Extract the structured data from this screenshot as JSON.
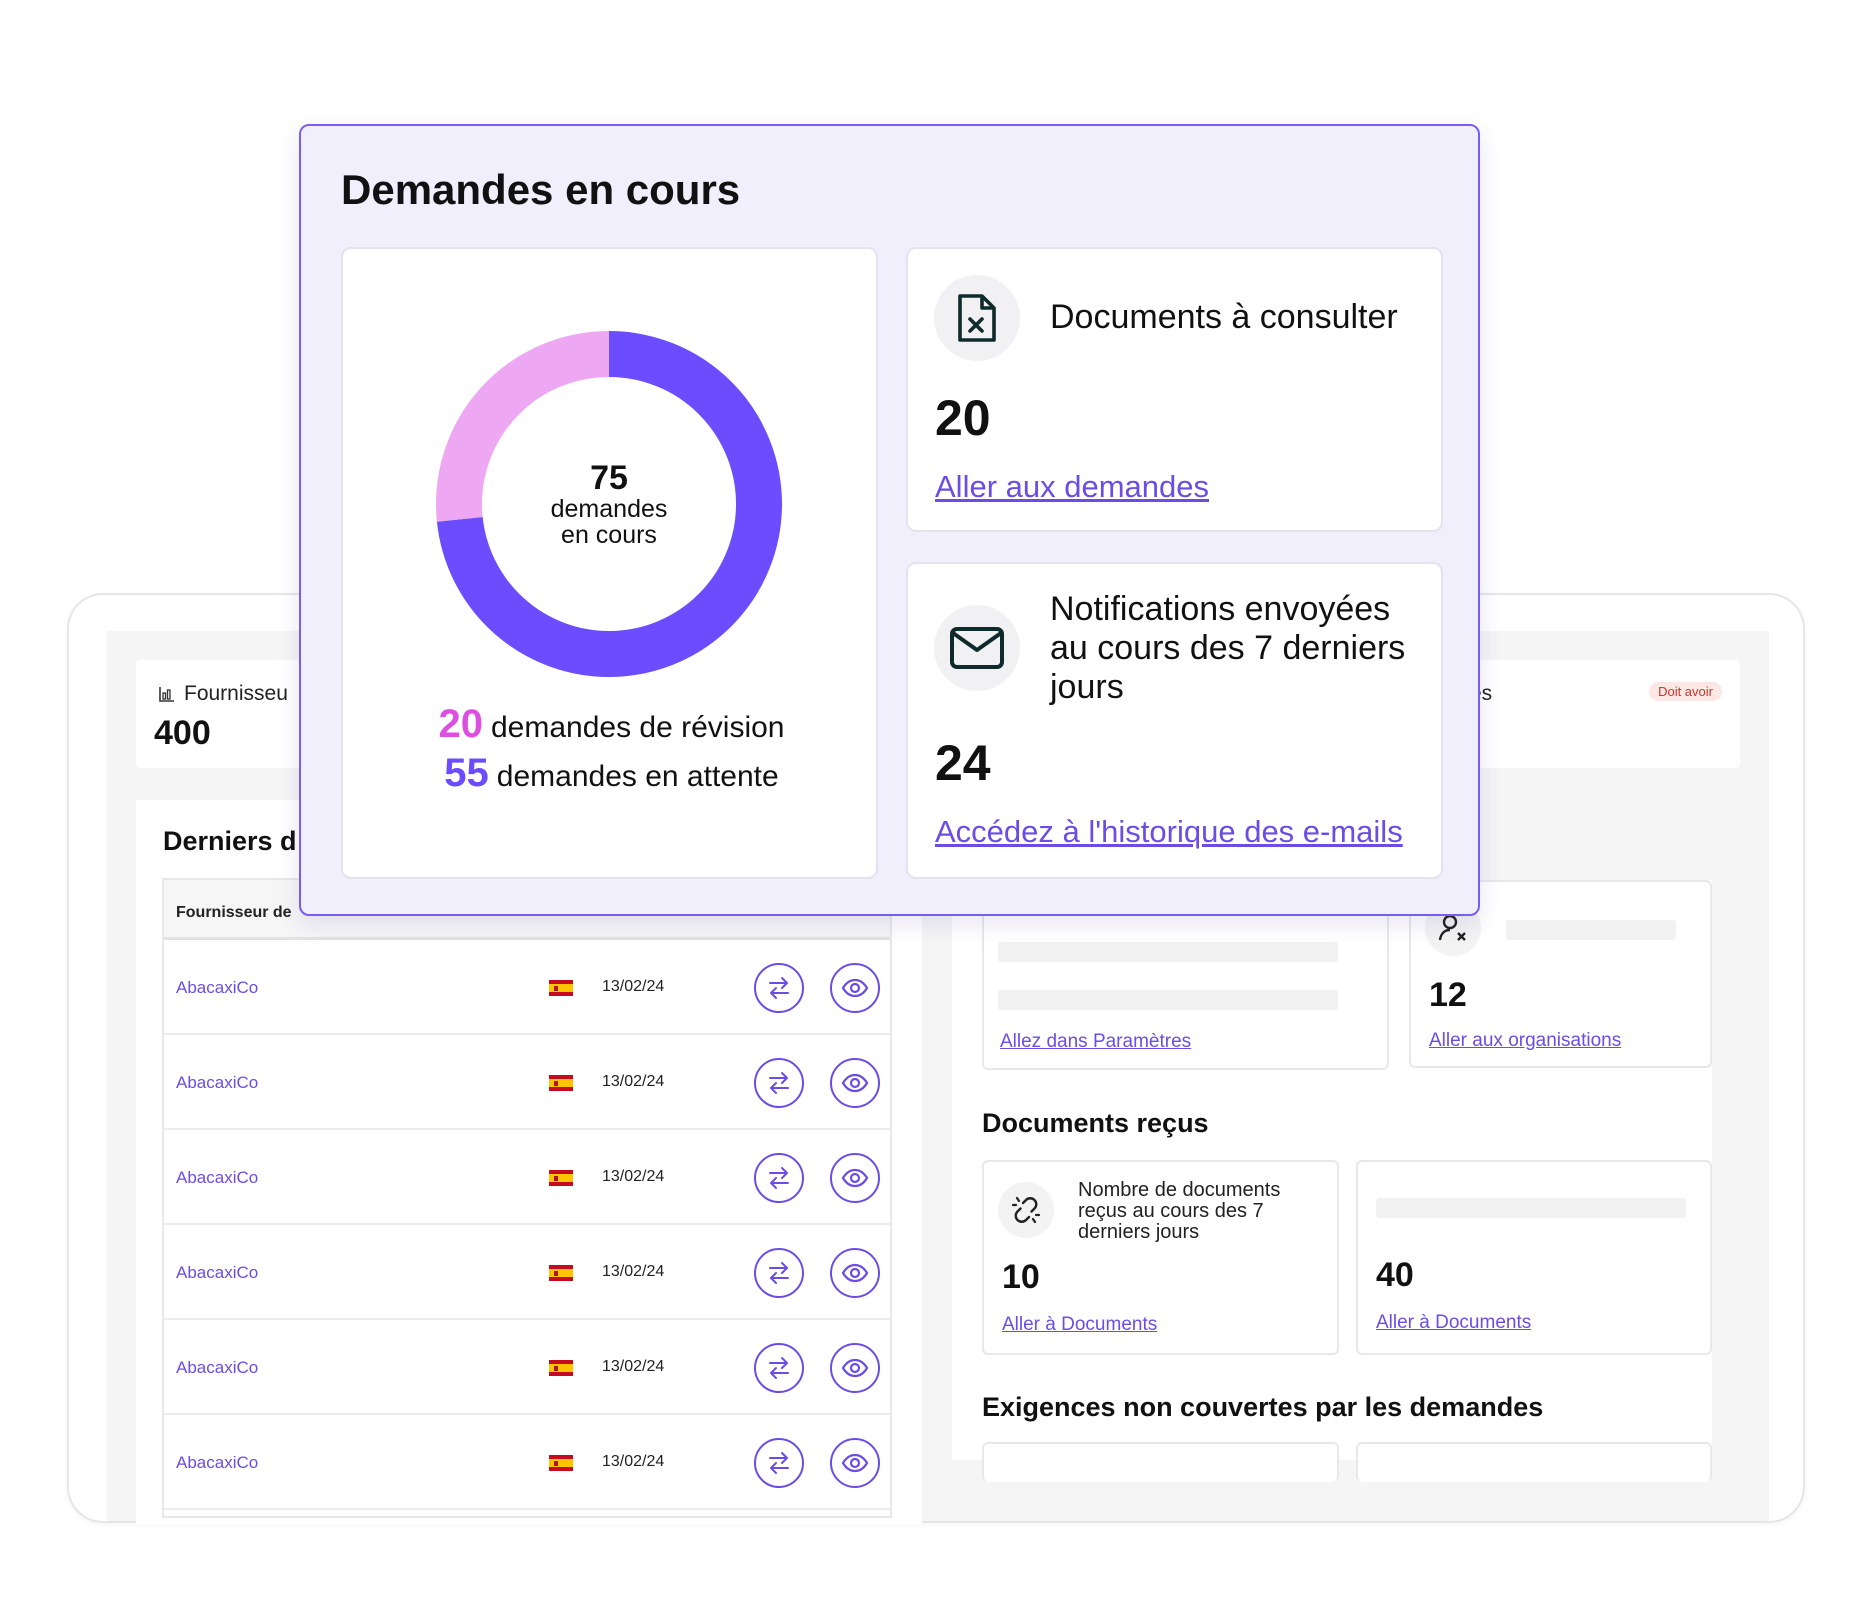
{
  "popup": {
    "title": "Demandes en cours",
    "donut": {
      "total": "75",
      "center_line1": "demandes",
      "center_line2": "en cours",
      "revision_count": "20",
      "revision_label": "demandes de révision",
      "attente_count": "55",
      "attente_label": "demandes en attente",
      "revision_value": 20,
      "attente_value": 55,
      "revision_color": "#eea7f2",
      "attente_color": "#6b4dff",
      "revision_text_color": "#dd4fe0",
      "attente_text_color": "#6b4dff"
    },
    "documents": {
      "label": "Documents à consulter",
      "value": "20",
      "link": "Aller aux demandes",
      "icon": "file-x-icon"
    },
    "notifications": {
      "label": "Notifications envoyées au cours des 7 derniers jours",
      "value": "24",
      "link": "Accédez à l'historique des e-mails",
      "icon": "mail-icon"
    }
  },
  "background": {
    "stat_left": {
      "label": "Fournisseu",
      "value": "400",
      "icon": "chart-icon"
    },
    "stat_right": {
      "label": "es",
      "badge": "Doit avoir"
    },
    "list": {
      "title": "Derniers d",
      "column_header": "Fournisseur de",
      "rows": [
        {
          "name": "AbacaxiCo",
          "date": "13/02/24"
        },
        {
          "name": "AbacaxiCo",
          "date": "13/02/24"
        },
        {
          "name": "AbacaxiCo",
          "date": "13/02/24"
        },
        {
          "name": "AbacaxiCo",
          "date": "13/02/24"
        },
        {
          "name": "AbacaxiCo",
          "date": "13/02/24"
        },
        {
          "name": "AbacaxiCo",
          "date": "13/02/24"
        }
      ]
    },
    "automations": {
      "link": "Allez dans Paramètres"
    },
    "organisations": {
      "value": "12",
      "link": "Aller aux organisations"
    },
    "documents_recus": {
      "title": "Documents reçus",
      "card1": {
        "label": "Nombre de documents reçus au cours des 7 derniers jours",
        "value": "10",
        "link": "Aller à Documents"
      },
      "card2": {
        "value": "40",
        "link": "Aller à Documents"
      }
    },
    "exigences": {
      "title": "Exigences non couvertes par les demandes"
    }
  },
  "colors": {
    "accent": "#6b4de6",
    "popup_bg": "#f1effb",
    "popup_border": "#7b5cf0"
  }
}
